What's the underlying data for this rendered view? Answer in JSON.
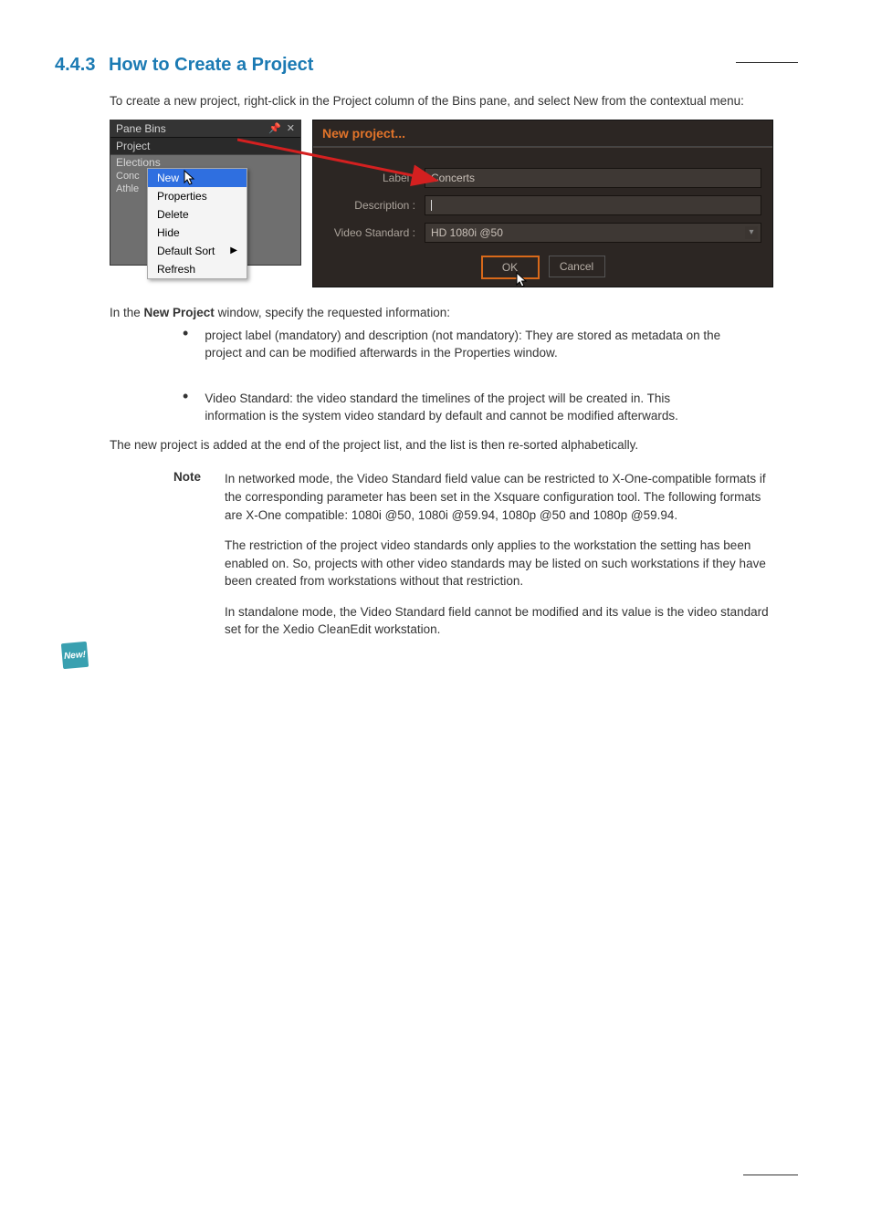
{
  "header": {
    "right": ""
  },
  "section": {
    "number": "4.4.3",
    "title": "How to Create a Project"
  },
  "intro": "To create a new project, right-click in the Project column of the Bins pane, and select New from the contextual menu:",
  "pane": {
    "title": "Pane Bins",
    "pin_icon_name": "pin-icon",
    "close_icon_name": "close-icon",
    "section_label": "Project",
    "items": [
      "Elections",
      "Conc",
      "Athle"
    ]
  },
  "context_menu": {
    "items": [
      "New",
      "Properties",
      "Delete",
      "Hide",
      "Default Sort",
      "Refresh"
    ],
    "selected_index": 0,
    "submenu_index": 4
  },
  "dialog": {
    "title": "New project...",
    "labels": {
      "label": "Label :",
      "description": "Description :",
      "video_standard": "Video Standard :"
    },
    "values": {
      "label": "Concerts",
      "description": "",
      "video_standard": "HD 1080i @50"
    },
    "buttons": {
      "ok": "OK",
      "cancel": "Cancel"
    }
  },
  "step2": {
    "lead": "In the ",
    "window_ref": "New Project",
    "after": " window, specify the requested information:"
  },
  "bullets": [
    "project label (mandatory) and description (not mandatory): They are stored as metadata on the project and can be modified afterwards in the Properties window.",
    "Video Standard: the video standard the timelines of the project will be created in. This information is the system video standard by default and cannot be modified afterwards."
  ],
  "new_badge": "New!",
  "post_list": "The new project is added at the end of the project list, and the list is then re-sorted alphabetically.",
  "note": {
    "label": "Note",
    "paragraphs": [
      "In networked mode, the Video Standard field value can be restricted to X-One-compatible formats if the corresponding parameter has been set in the Xsquare configuration tool. The following formats are X-One compatible: 1080i @50, 1080i @59.94, 1080p @50 and 1080p @59.94.",
      "The restriction of the project video standards only applies to the workstation the setting has been enabled on. So, projects with other video standards may be listed on such workstations if they have been created from workstations without that restriction.",
      "In standalone mode, the Video Standard field cannot be modified and its value is the video standard set for the Xedio CleanEdit workstation."
    ]
  },
  "footer": {
    "left": "",
    "right": ""
  }
}
